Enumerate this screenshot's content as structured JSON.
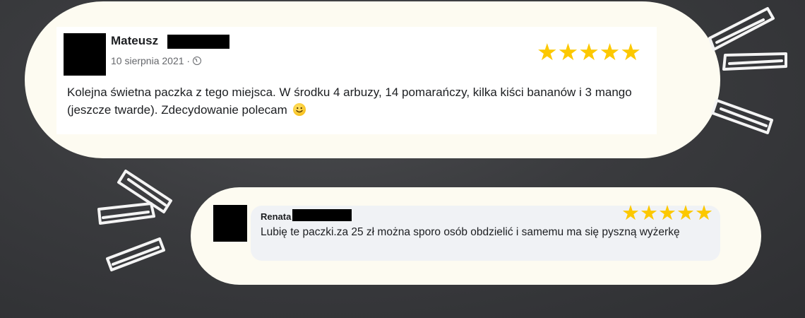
{
  "review1": {
    "author": "Mateusz",
    "date": "10 sierpnia 2021 ·",
    "privacy_icon": "globe-icon",
    "text": "Kolejna świetna paczka z tego miejsca. W środku 4 arbuzy, 14 pomarańczy, kilka kiści bananów i 3 mango (jeszcze twarde). Zdecydowanie polecam",
    "emoji": "smiley-emoji",
    "rating": 5
  },
  "review2": {
    "author": "Renata",
    "text": "Lubię te paczki.za 25 zł można sporo osób obdzielić i samemu ma się pyszną wyżerkę",
    "rating": 5
  },
  "colors": {
    "star": "#fcc800",
    "bubble": "#fdfbf1",
    "background": "#3a3b3e"
  }
}
